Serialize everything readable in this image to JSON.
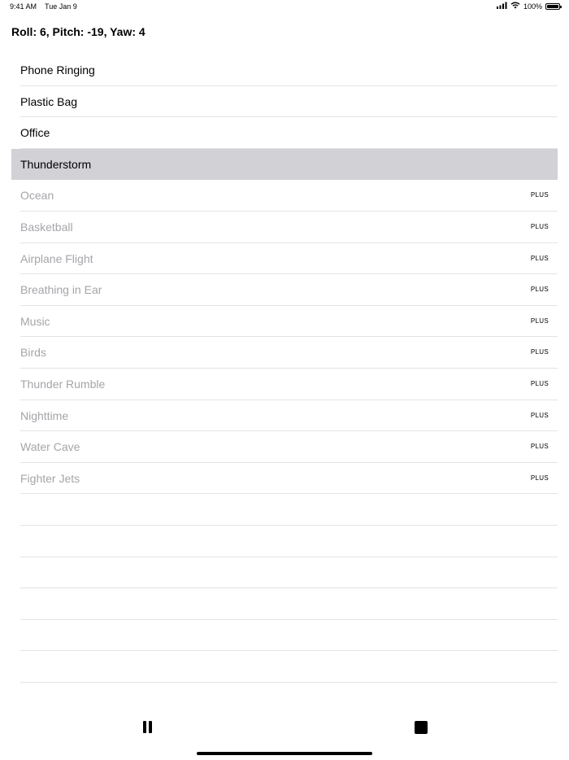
{
  "status_bar": {
    "time": "9:41 AM",
    "date": "Tue Jan 9",
    "battery": "100%",
    "battery_level": 1.0,
    "icons": [
      "cellular-signal-icon",
      "wifi-icon",
      "battery-icon"
    ]
  },
  "attitude": {
    "text": "Roll: 6, Pitch: -19, Yaw: 4"
  },
  "sounds": [
    {
      "label": "Phone Ringing",
      "badge": null,
      "selected": false,
      "locked": false
    },
    {
      "label": "Plastic Bag",
      "badge": null,
      "selected": false,
      "locked": false
    },
    {
      "label": "Office",
      "badge": null,
      "selected": false,
      "locked": false
    },
    {
      "label": "Thunderstorm",
      "badge": null,
      "selected": true,
      "locked": false
    },
    {
      "label": "Ocean",
      "badge": "PLUS",
      "selected": false,
      "locked": true
    },
    {
      "label": "Basketball",
      "badge": "PLUS",
      "selected": false,
      "locked": true
    },
    {
      "label": "Airplane Flight",
      "badge": "PLUS",
      "selected": false,
      "locked": true
    },
    {
      "label": "Breathing in Ear",
      "badge": "PLUS",
      "selected": false,
      "locked": true
    },
    {
      "label": "Music",
      "badge": "PLUS",
      "selected": false,
      "locked": true
    },
    {
      "label": "Birds",
      "badge": "PLUS",
      "selected": false,
      "locked": true
    },
    {
      "label": "Thunder Rumble",
      "badge": "PLUS",
      "selected": false,
      "locked": true
    },
    {
      "label": "Nighttime",
      "badge": "PLUS",
      "selected": false,
      "locked": true
    },
    {
      "label": "Water Cave",
      "badge": "PLUS",
      "selected": false,
      "locked": true
    },
    {
      "label": "Fighter Jets",
      "badge": "PLUS",
      "selected": false,
      "locked": true
    }
  ],
  "controls": {
    "pause_icon": "pause-icon",
    "stop_icon": "stop-icon"
  },
  "colors": {
    "selected_row": "#d1d1d6",
    "locked_text": "#a5a5aa",
    "separator": "#e3e3e6"
  }
}
